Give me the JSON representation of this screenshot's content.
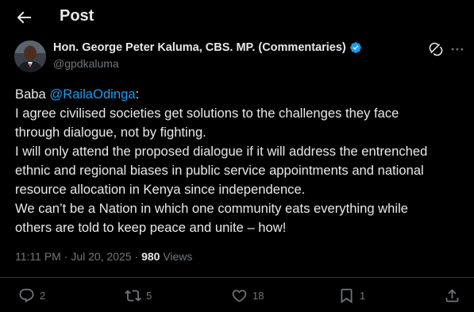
{
  "header": {
    "title": "Post",
    "back_icon": "arrow-left-icon"
  },
  "author": {
    "name": "Hon. George Peter Kaluma, CBS. MP. (Commentaries)",
    "handle": "@gpdkaluma",
    "verified_color": "#1d9bf0"
  },
  "post": {
    "greeting": "Baba ",
    "mention": "@RailaOdinga",
    "greeting_suffix": ":",
    "lines": [
      "I agree civilised societies get solutions to the challenges they face",
      "through dialogue, not by fighting.",
      "I will only attend the proposed dialogue if it will address the entrenched",
      "ethnic and regional biases in public service appointments and national",
      "resource allocation in Kenya since independence.",
      "We can’t be a Nation in which one community eats everything while",
      "others are told to keep peace and unite – how!"
    ],
    "time": "11:11 PM",
    "date": "Jul 20, 2025",
    "views_count": "980",
    "views_label": "Views"
  },
  "actions": {
    "replies": "2",
    "reposts": "5",
    "likes": "18",
    "bookmarks": "1"
  },
  "colors": {
    "background": "#000000",
    "text": "#e7e9ea",
    "muted": "#71767b",
    "accent": "#1d9bf0"
  }
}
